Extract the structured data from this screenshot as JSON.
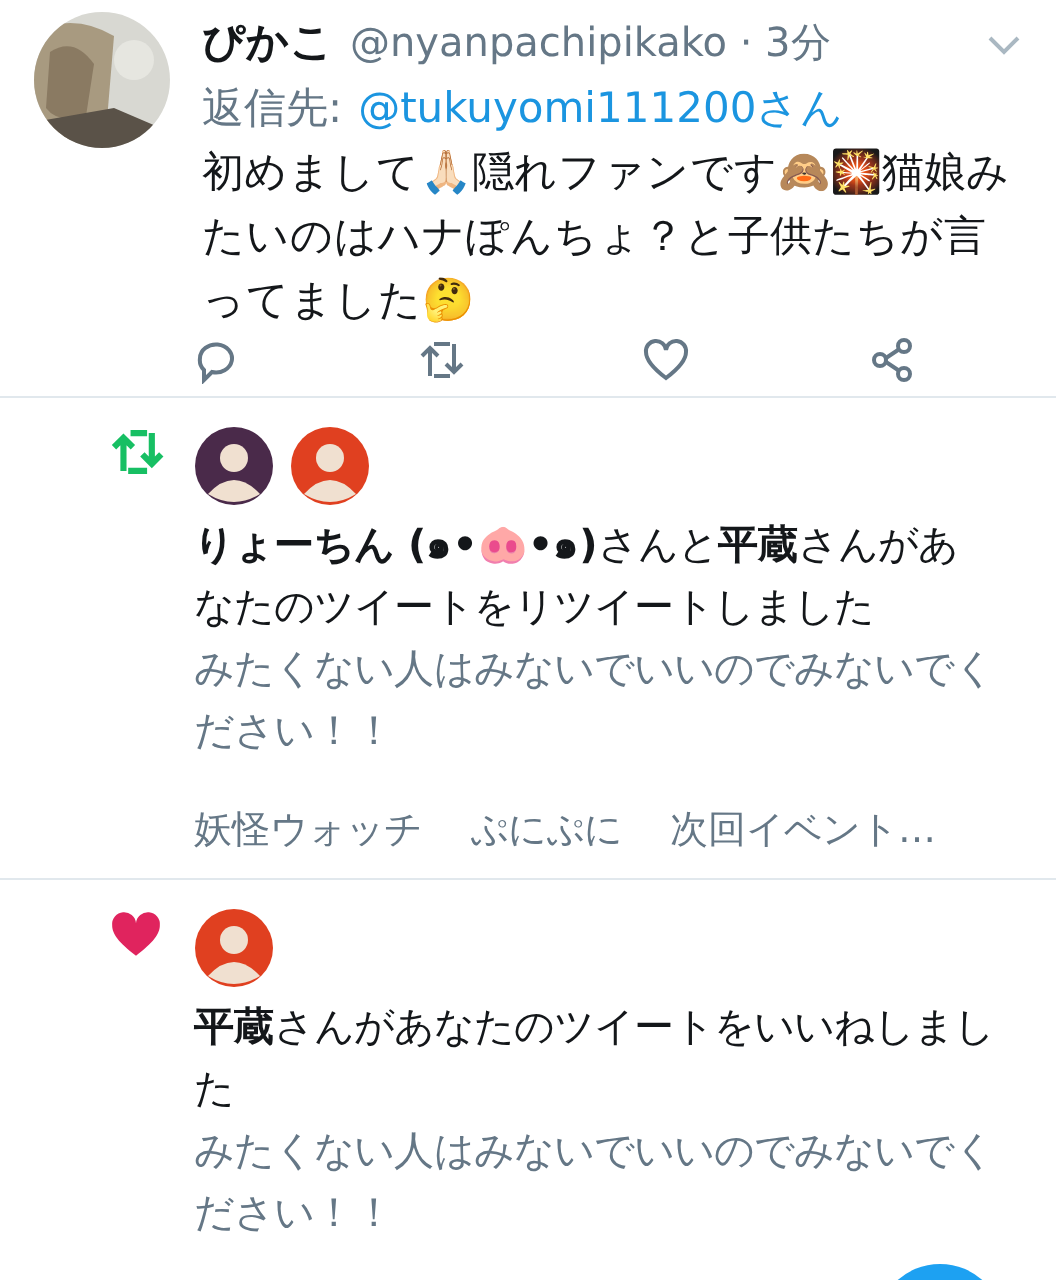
{
  "tweet": {
    "author": "ぴかこ",
    "meta": "@nyanpachipikako · 3分",
    "reply_label": "返信先:",
    "reply_to": "@tukuyomi111200さん",
    "text": "初めまして🙏🏻隠れファンです🙈🎇猫娘みたいのはハナぽんちょ？と子供たちが言ってました🤔",
    "actions": [
      {
        "kind": "reply"
      },
      {
        "kind": "retweet"
      },
      {
        "kind": "like"
      },
      {
        "kind": "share"
      }
    ]
  },
  "notifications": [
    {
      "kind": "retweet",
      "avatars": [
        {
          "color": "#4a2a4a"
        },
        {
          "color": "#e04020"
        }
      ],
      "text": "**りょーちん (๑•🐽•๑)**さんと**平蔵**さんがあなたのツイートをリツイートしました",
      "quote": "みたくない人はみないでいいのでみないでください！！",
      "tags": [
        "妖怪ウォッチ",
        "ぷにぷに",
        "次回イベント…"
      ]
    },
    {
      "kind": "like",
      "avatars": [
        {
          "color": "#e04020"
        }
      ],
      "text": "**平蔵**さんがあなたのツイートをいいねしました",
      "quote": "みたくない人はみないでいいのでみないでください！！"
    }
  ]
}
